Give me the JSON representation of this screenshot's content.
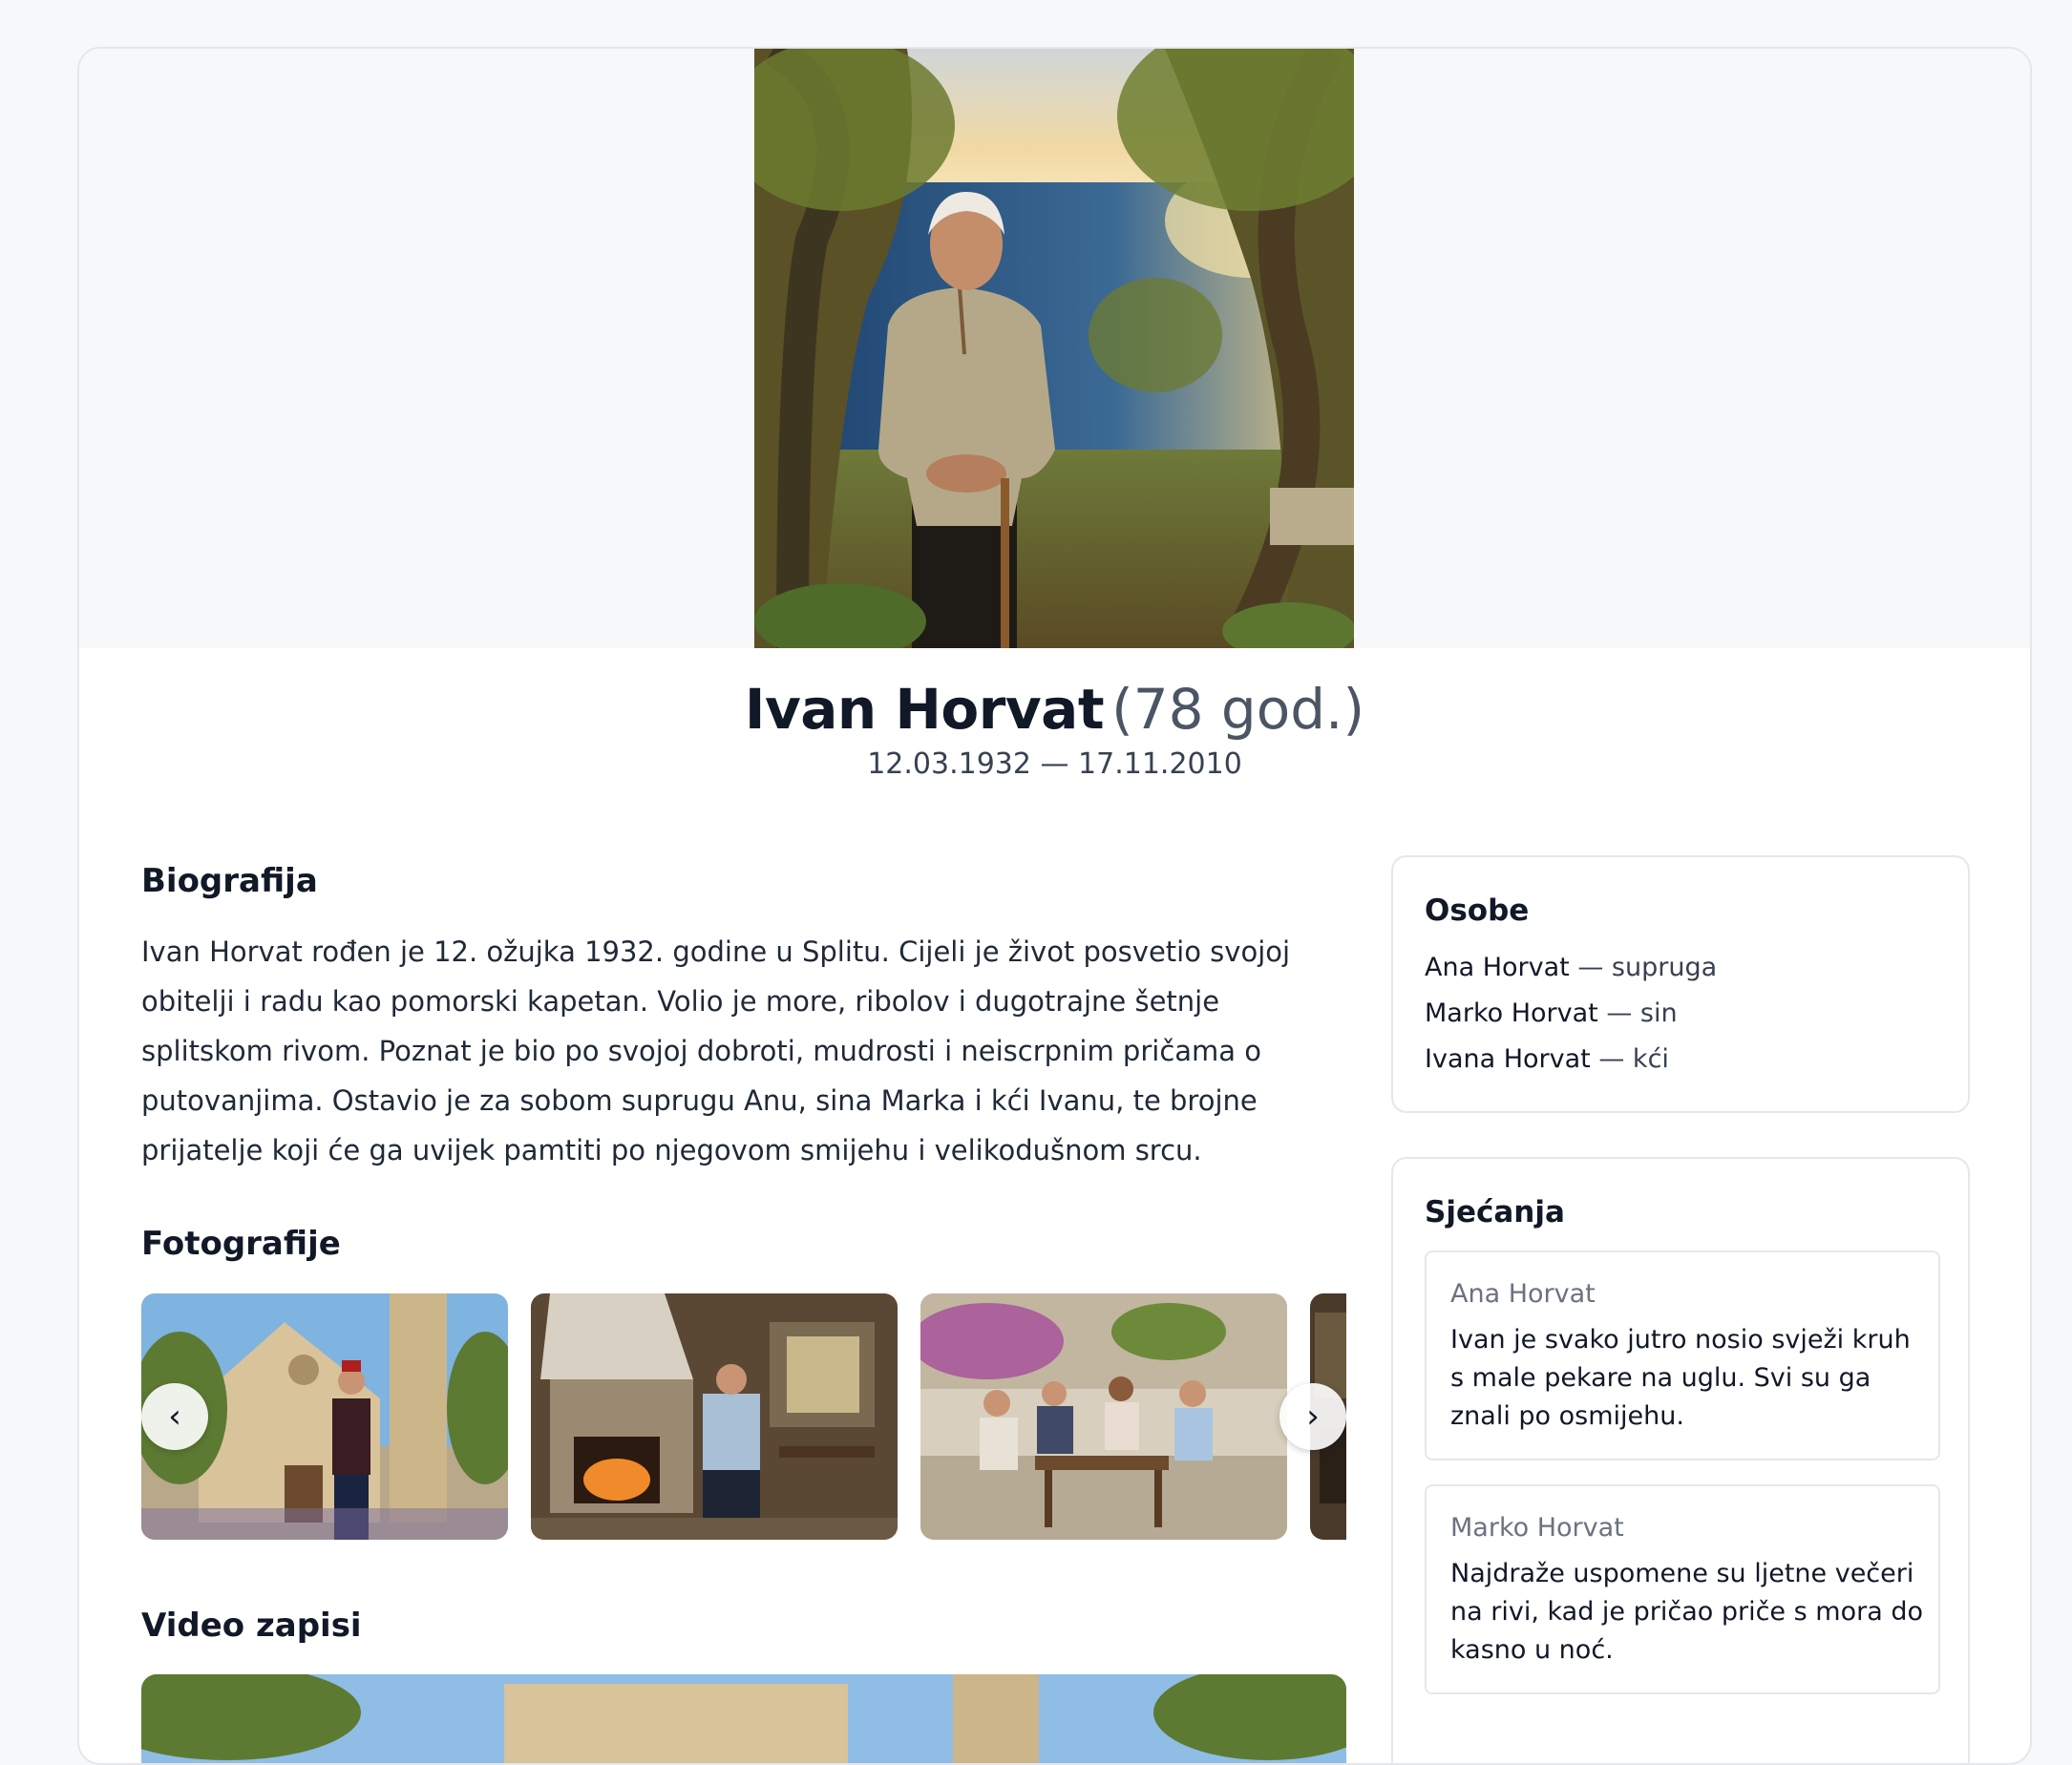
{
  "profile": {
    "name": "Ivan Horvat",
    "age": "(78 god.)",
    "dates": "12.03.1932 — 17.11.2010"
  },
  "biography": {
    "title": "Biografija",
    "text": "Ivan Horvat rođen je 12. ožujka 1932. godine u Splitu. Cijeli je život posvetio svojoj obitelji i radu kao pomorski kapetan. Volio je more, ribolov i dugotrajne šetnje splitskom rivom. Poznat je bio po svojoj dobroti, mudrosti i neiscrpnim pričama o putovanjima. Ostavio je za sobom suprugu Anu, sina Marka i kći Ivanu, te brojne prijatelje koji će ga uvijek pamtiti po njegovom smijehu i velikodušnom srcu."
  },
  "photos": {
    "title": "Fotografije",
    "prev_icon": "chevron-left-icon",
    "next_icon": "chevron-right-icon"
  },
  "videos": {
    "title": "Video zapisi"
  },
  "people": {
    "title": "Osobe",
    "items": [
      {
        "name": "Ana Horvat",
        "relation": " — supruga"
      },
      {
        "name": "Marko Horvat",
        "relation": " — sin"
      },
      {
        "name": "Ivana Horvat",
        "relation": " — kći"
      }
    ]
  },
  "memories": {
    "title": "Sjećanja",
    "items": [
      {
        "author": "Ana Horvat",
        "text": "Ivan je svako jutro nosio svježi kruh s male pekare na uglu. Svi su ga znali po osmijehu."
      },
      {
        "author": "Marko Horvat",
        "text": "Najdraže uspomene su ljetne večeri na rivi, kad je pričao priče s mora do kasno u noć."
      }
    ]
  },
  "colors": {
    "background": "#f7f8fa",
    "card": "#ffffff",
    "border": "#e5e7eb",
    "text": "#111827",
    "muted": "#6b7280"
  }
}
